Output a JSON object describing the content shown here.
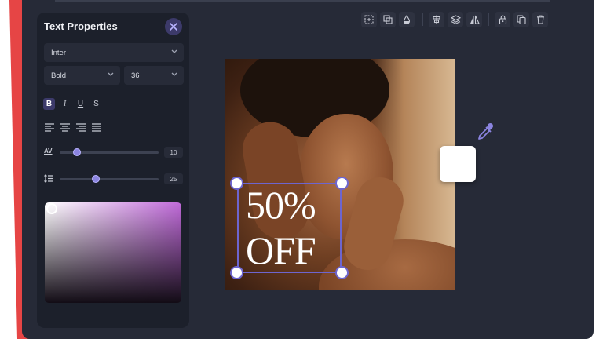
{
  "panel": {
    "title": "Text Properties",
    "font_family": "Inter",
    "font_weight": "Bold",
    "font_size": "36",
    "format_buttons": [
      "B",
      "I",
      "U",
      "S"
    ],
    "letter_spacing_icon_label": "AV",
    "letter_spacing_value": "10",
    "line_height_value": "25",
    "letter_spacing_level": 0.15,
    "line_height_level": 0.35
  },
  "canvas": {
    "text_line1": "50%",
    "text_line2": "OFF"
  },
  "toolbar": {
    "icons": [
      "select-area-icon",
      "group-icon",
      "opacity-icon",
      "align-icon",
      "layers-icon",
      "flip-icon",
      "lock-icon",
      "duplicate-icon",
      "delete-icon"
    ]
  },
  "colors": {
    "accent": "#6d65cf",
    "panel_bg": "#1c202b",
    "app_bg": "#262a37",
    "picker_hue": "#c06ad9",
    "swatch": "#ffffff"
  }
}
